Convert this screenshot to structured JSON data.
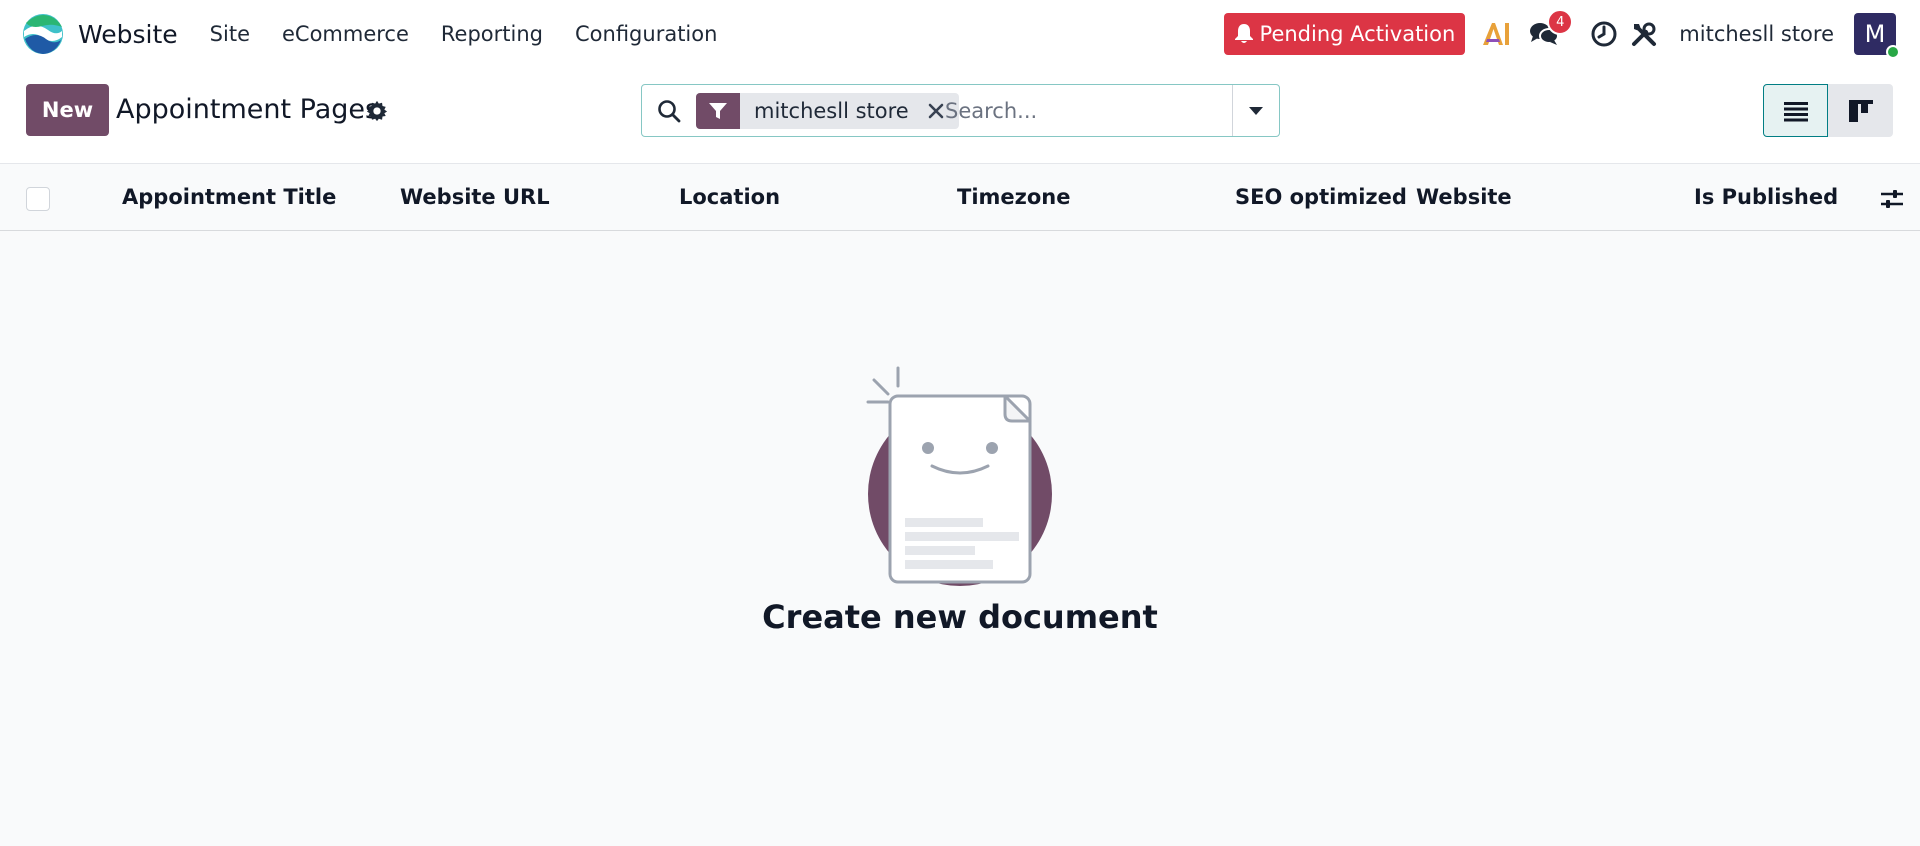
{
  "navbar": {
    "app_name": "Website",
    "menu": [
      "Site",
      "eCommerce",
      "Reporting",
      "Configuration"
    ],
    "pending_label": "Pending Activation",
    "messages_count": "4",
    "company": "mitchesll store",
    "avatar_letter": "M"
  },
  "control": {
    "new_label": "New",
    "title": "Appointment Pages",
    "facet_label": "mitchesll store",
    "search_placeholder": "Search..."
  },
  "list": {
    "columns": [
      "Appointment Title",
      "Website URL",
      "Location",
      "Timezone",
      "SEO optimized",
      "Website",
      "Is Published"
    ]
  },
  "empty": {
    "title": "Create new document"
  },
  "colors": {
    "brand": "#714b67",
    "danger": "#dc3545",
    "teal": "#017e84"
  }
}
